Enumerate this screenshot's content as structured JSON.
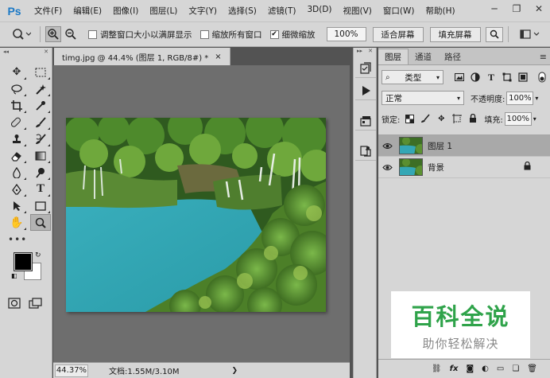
{
  "app": {
    "logo": "Ps"
  },
  "menu": [
    "文件(F)",
    "编辑(E)",
    "图像(I)",
    "图层(L)",
    "文字(Y)",
    "选择(S)",
    "滤镜(T)",
    "3D(D)",
    "视图(V)",
    "窗口(W)",
    "帮助(H)"
  ],
  "window_controls": {
    "minimize": "─",
    "restore": "❐",
    "close": "✕"
  },
  "options": {
    "resize_windows_label": "调整窗口大小以满屏显示",
    "resize_windows_checked": false,
    "zoom_all_label": "缩放所有窗口",
    "zoom_all_checked": false,
    "scrubby_zoom_label": "细微缩放",
    "scrubby_zoom_checked": true,
    "zoom_percent": "100%",
    "fit_screen_label": "适合屏幕",
    "fill_screen_label": "填充屏幕"
  },
  "document": {
    "tab_title": "timg.jpg @ 44.4% (图层 1, RGB/8#) *",
    "close": "×"
  },
  "statusbar": {
    "zoom": "44.37%",
    "doc_info": "文档:1.55M/3.10M",
    "arrow": "❯"
  },
  "layers_panel": {
    "tabs": [
      "图层",
      "通道",
      "路径"
    ],
    "active_tab": 0,
    "filter_kind": "类型",
    "blend_mode": "正常",
    "opacity_label": "不透明度:",
    "opacity_value": "100%",
    "lock_label": "锁定:",
    "fill_label": "填充:",
    "fill_value": "100%",
    "layers": [
      {
        "name": "图层 1",
        "selected": true,
        "locked": false
      },
      {
        "name": "背景",
        "selected": false,
        "locked": true
      }
    ]
  },
  "watermark": {
    "title": "百科全说",
    "subtitle": "助你轻松解决"
  },
  "colors": {
    "accent": "#1c79c6",
    "watermark_green": "#2fa34a",
    "foreground": "#000000",
    "background": "#ffffff"
  }
}
